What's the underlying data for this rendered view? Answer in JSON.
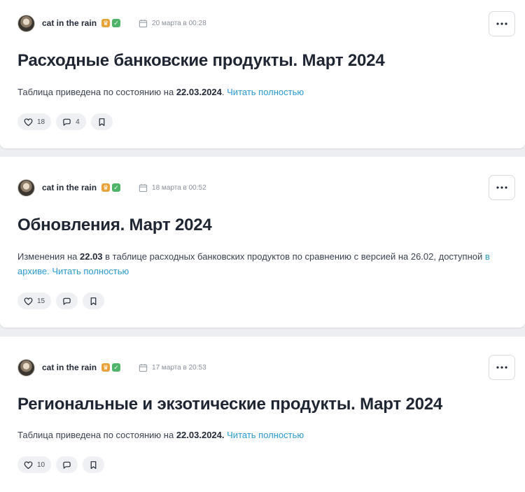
{
  "posts": [
    {
      "author": "cat in the rain",
      "date": "20 марта в 00:28",
      "title": "Расходные банковские продукты. Март 2024",
      "excerpt": {
        "t1": "Таблица приведена по состоянию на ",
        "b1": "22.03.2024",
        "t2": ". ",
        "read_more": "Читать полностью"
      },
      "likes": "18",
      "comments": "4"
    },
    {
      "author": "cat in the rain",
      "date": "18 марта в 00:52",
      "title": "Обновления. Март 2024",
      "excerpt": {
        "t1": "Изменения на ",
        "b1": "22.03",
        "t2": " в таблице расходных банковских продуктов по сравнению с версией на 26.02, доступной ",
        "archive_link": "в архиве",
        "t3": ". ",
        "read_more": "Читать полностью"
      },
      "likes": "15",
      "comments": ""
    },
    {
      "author": "cat in the rain",
      "date": "17 марта в 20:53",
      "title": "Региональные и экзотические продукты. Март 2024",
      "excerpt": {
        "t1": "Таблица приведена по состоянию на ",
        "b1": "22.03.2024.",
        "t2": " ",
        "read_more": "Читать полностью"
      },
      "likes": "10",
      "comments": ""
    }
  ],
  "colors": {
    "link": "#2a9ad1",
    "premium_badge": "#e8a23a",
    "verified_badge": "#4fb46a",
    "title": "#1e2533"
  },
  "icons": {
    "premium_badge": "crown-icon",
    "verified_badge": "check-icon",
    "date": "calendar-icon",
    "more": "more-dots-icon",
    "like": "heart-icon",
    "comment": "comment-icon",
    "bookmark": "bookmark-icon"
  }
}
